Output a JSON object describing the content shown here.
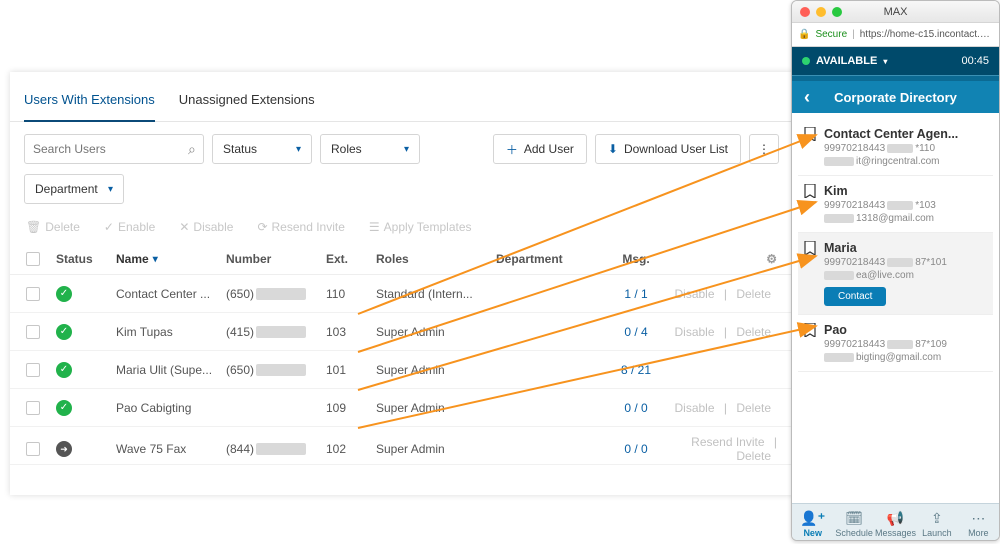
{
  "tabs": {
    "users_with_extensions": "Users With Extensions",
    "unassigned": "Unassigned Extensions"
  },
  "search": {
    "placeholder": "Search Users"
  },
  "filters": {
    "status": "Status",
    "roles": "Roles",
    "department": "Department"
  },
  "buttons": {
    "add_user": "Add User",
    "download": "Download User List"
  },
  "disabled_actions": {
    "delete": "Delete",
    "enable": "Enable",
    "disable": "Disable",
    "resend": "Resend Invite",
    "apply_templates": "Apply Templates"
  },
  "columns": {
    "status": "Status",
    "name": "Name",
    "number": "Number",
    "ext": "Ext.",
    "roles": "Roles",
    "department": "Department",
    "msg": "Msg."
  },
  "rows": [
    {
      "status": "green",
      "name": "Contact Center ...",
      "num_prefix": "(650)",
      "ext": "110",
      "role": "Standard (Intern...",
      "msg": "1 / 1",
      "actions": [
        "Disable",
        "Delete"
      ]
    },
    {
      "status": "green",
      "name": "Kim Tupas",
      "num_prefix": "(415)",
      "ext": "103",
      "role": "Super Admin",
      "msg": "0 / 4",
      "actions": [
        "Disable",
        "Delete"
      ]
    },
    {
      "status": "green",
      "name": "Maria Ulit (Supe...",
      "num_prefix": "(650)",
      "ext": "101",
      "role": "Super Admin",
      "msg": "8 / 21",
      "actions": []
    },
    {
      "status": "green",
      "name": "Pao Cabigting",
      "num_prefix": "",
      "ext": "109",
      "role": "Super Admin",
      "msg": "0 / 0",
      "actions": [
        "Disable",
        "Delete"
      ]
    },
    {
      "status": "gray",
      "name": "Wave 75 Fax",
      "num_prefix": "(844)",
      "ext": "102",
      "role": "Super Admin",
      "msg": "0 / 0",
      "actions": [
        "Resend Invite",
        "Delete"
      ]
    }
  ],
  "softphone": {
    "window_title": "MAX",
    "secure": "Secure",
    "url": "https://home-c15.incontact.co...",
    "status_label": "AVAILABLE",
    "status_time": "00:45",
    "dir_title": "Corporate Directory",
    "contacts": [
      {
        "name": "Contact Center Agen...",
        "line2_a": "99970218443",
        "line2_b": "*110",
        "email_suffix": "it@ringcentral.com",
        "selected": false
      },
      {
        "name": "Kim",
        "line2_a": "99970218443",
        "line2_b": "*103",
        "email_suffix": "1318@gmail.com",
        "selected": false
      },
      {
        "name": "Maria",
        "line2_a": "99970218443",
        "line2_b": "87*101",
        "email_suffix": "ea@live.com",
        "selected": true
      },
      {
        "name": "Pao",
        "line2_a": "99970218443",
        "line2_b": "87*109",
        "email_suffix": "bigting@gmail.com",
        "selected": false
      }
    ],
    "contact_btn": "Contact",
    "bottom": {
      "new": "New",
      "schedule": "Schedule",
      "messages": "Messages",
      "launch": "Launch",
      "more": "More"
    }
  }
}
